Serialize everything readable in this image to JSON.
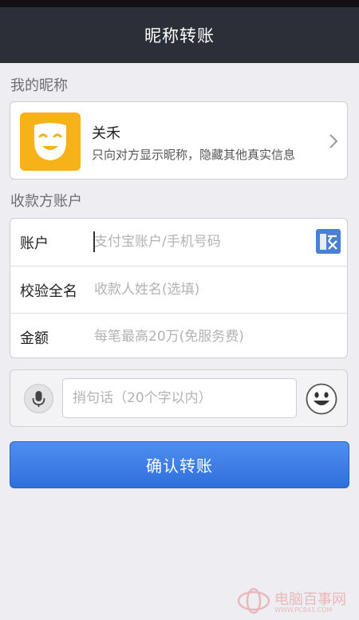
{
  "header": {
    "title": "昵称转账"
  },
  "nickname_section": {
    "label": "我的昵称",
    "name": "关禾",
    "description": "只向对方显示昵称，隐藏其他真实信息"
  },
  "payee_section": {
    "label": "收款方账户",
    "fields": [
      {
        "label": "账户",
        "placeholder": "支付宝账户/手机号码",
        "value": ""
      },
      {
        "label": "校验全名",
        "placeholder": "收款人姓名(选填)",
        "value": ""
      },
      {
        "label": "金额",
        "placeholder": "每笔最高20万(免服务费)",
        "value": ""
      }
    ]
  },
  "memo": {
    "placeholder": "捎句话（20个字以内）",
    "value": ""
  },
  "confirm": {
    "label": "确认转账"
  },
  "watermark": {
    "text": "电脑百事网",
    "url": "WWW.PC841.COM"
  },
  "colors": {
    "header_bg": "#2c2f38",
    "accent": "#3a7be6",
    "avatar_bg": "#f7b21a"
  }
}
